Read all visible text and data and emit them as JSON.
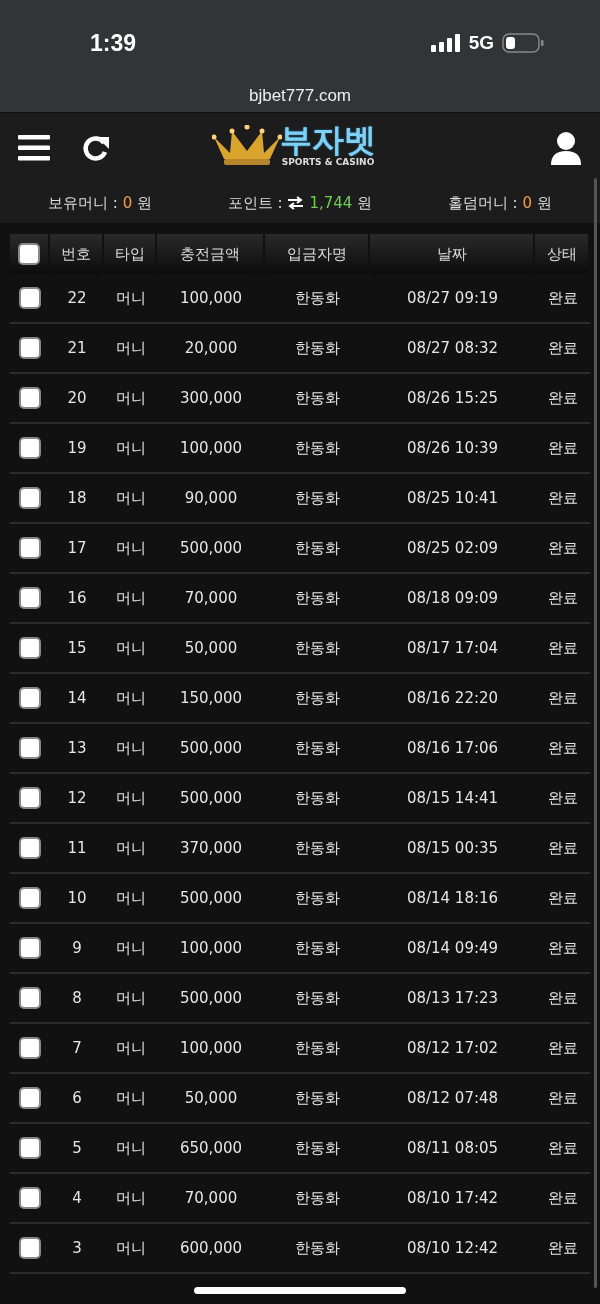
{
  "status_bar": {
    "time": "1:39",
    "network": "5G"
  },
  "url_bar": {
    "url": "bjbet777.com"
  },
  "header": {
    "logo_text": "부자벳",
    "logo_sub": "SPORTS & CASINO"
  },
  "balances": [
    {
      "label": "보유머니 :",
      "value": "0",
      "unit": "원",
      "kind": "money"
    },
    {
      "label": "포인트 :",
      "value": "1,744",
      "unit": "원",
      "kind": "point"
    },
    {
      "label": "홀덤머니 :",
      "value": "0",
      "unit": "원",
      "kind": "money"
    }
  ],
  "table": {
    "header_checked": false,
    "columns": [
      "번호",
      "타입",
      "충전금액",
      "입금자명",
      "날짜",
      "상태"
    ],
    "rows": [
      {
        "checked": false,
        "cells": [
          "22",
          "머니",
          "100,000",
          "한동화",
          "08/27 09:19",
          "완료"
        ]
      },
      {
        "checked": false,
        "cells": [
          "21",
          "머니",
          "20,000",
          "한동화",
          "08/27 08:32",
          "완료"
        ]
      },
      {
        "checked": false,
        "cells": [
          "20",
          "머니",
          "300,000",
          "한동화",
          "08/26 15:25",
          "완료"
        ]
      },
      {
        "checked": false,
        "cells": [
          "19",
          "머니",
          "100,000",
          "한동화",
          "08/26 10:39",
          "완료"
        ]
      },
      {
        "checked": false,
        "cells": [
          "18",
          "머니",
          "90,000",
          "한동화",
          "08/25 10:41",
          "완료"
        ]
      },
      {
        "checked": false,
        "cells": [
          "17",
          "머니",
          "500,000",
          "한동화",
          "08/25 02:09",
          "완료"
        ]
      },
      {
        "checked": false,
        "cells": [
          "16",
          "머니",
          "70,000",
          "한동화",
          "08/18 09:09",
          "완료"
        ]
      },
      {
        "checked": false,
        "cells": [
          "15",
          "머니",
          "50,000",
          "한동화",
          "08/17 17:04",
          "완료"
        ]
      },
      {
        "checked": false,
        "cells": [
          "14",
          "머니",
          "150,000",
          "한동화",
          "08/16 22:20",
          "완료"
        ]
      },
      {
        "checked": false,
        "cells": [
          "13",
          "머니",
          "500,000",
          "한동화",
          "08/16 17:06",
          "완료"
        ]
      },
      {
        "checked": false,
        "cells": [
          "12",
          "머니",
          "500,000",
          "한동화",
          "08/15 14:41",
          "완료"
        ]
      },
      {
        "checked": false,
        "cells": [
          "11",
          "머니",
          "370,000",
          "한동화",
          "08/15 00:35",
          "완료"
        ]
      },
      {
        "checked": false,
        "cells": [
          "10",
          "머니",
          "500,000",
          "한동화",
          "08/14 18:16",
          "완료"
        ]
      },
      {
        "checked": false,
        "cells": [
          "9",
          "머니",
          "100,000",
          "한동화",
          "08/14 09:49",
          "완료"
        ]
      },
      {
        "checked": false,
        "cells": [
          "8",
          "머니",
          "500,000",
          "한동화",
          "08/13 17:23",
          "완료"
        ]
      },
      {
        "checked": false,
        "cells": [
          "7",
          "머니",
          "100,000",
          "한동화",
          "08/12 17:02",
          "완료"
        ]
      },
      {
        "checked": false,
        "cells": [
          "6",
          "머니",
          "50,000",
          "한동화",
          "08/12 07:48",
          "완료"
        ]
      },
      {
        "checked": false,
        "cells": [
          "5",
          "머니",
          "650,000",
          "한동화",
          "08/11 08:05",
          "완료"
        ]
      },
      {
        "checked": false,
        "cells": [
          "4",
          "머니",
          "70,000",
          "한동화",
          "08/10 17:42",
          "완료"
        ]
      },
      {
        "checked": false,
        "cells": [
          "3",
          "머니",
          "600,000",
          "한동화",
          "08/10 12:42",
          "완료"
        ]
      }
    ]
  }
}
